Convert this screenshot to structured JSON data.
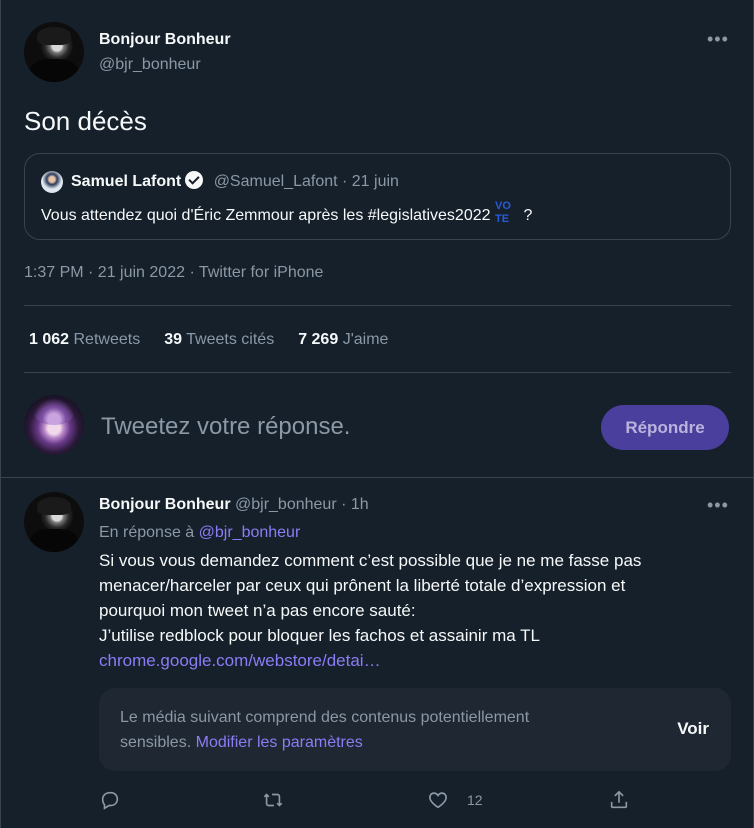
{
  "main_tweet": {
    "display_name": "Bonjour Bonheur",
    "handle": "@bjr_bonheur",
    "text": "Son décès",
    "meta": "1:37 PM · 21 juin 2022 · Twitter for iPhone"
  },
  "quote": {
    "display_name": "Samuel Lafont",
    "handle_date": "@Samuel_Lafont · 21 juin",
    "text": "Vous attendez quoi d'Éric Zemmour après les #legislatives2022",
    "vote_top": "VO",
    "vote_bottom": "TE",
    "text_end": "?"
  },
  "stats": {
    "retweets_count": "1 062",
    "retweets_label": "Retweets",
    "quotes_count": "39",
    "quotes_label": "Tweets cités",
    "likes_count": "7 269",
    "likes_label": "J'aime"
  },
  "composer": {
    "placeholder": "Tweetez votre réponse.",
    "button": "Répondre"
  },
  "reply": {
    "display_name": "Bonjour Bonheur",
    "handle_time": "@bjr_bonheur · 1h",
    "in_reply_prefix": "En réponse à",
    "in_reply_handle": "@bjr_bonheur",
    "line1": "Si vous vous demandez comment c’est possible que je ne me fasse pas",
    "line2": "menacer/harceler par ceux qui prônent la liberté totale d’expression et",
    "line3": "pourquoi mon tweet n’a pas encore sauté:",
    "line4": "J’utilise redblock pour bloquer les fachos et assainir ma TL",
    "link": "chrome.google.com/webstore/detai…",
    "sensitive_line1": "Le média suivant comprend des contenus potentiellement",
    "sensitive_line2": "sensibles.",
    "sensitive_link": "Modifier les paramètres",
    "sensitive_button": "Voir",
    "likes": "12"
  },
  "icons": {
    "more": "more-icon",
    "reply": "reply-icon",
    "retweet": "retweet-icon",
    "like": "like-icon",
    "share": "share-icon",
    "verified": "verified-icon"
  },
  "colors": {
    "background": "#15202b",
    "accent": "#8c7cf5",
    "button": "#4a3f9c",
    "muted": "#8b98a5"
  }
}
